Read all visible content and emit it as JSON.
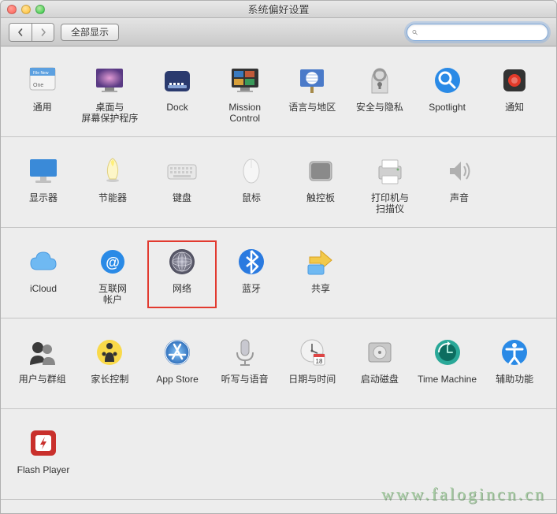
{
  "window": {
    "title": "系统偏好设置"
  },
  "toolbar": {
    "back_aria": "back",
    "forward_aria": "forward",
    "showall_label": "全部显示",
    "search_placeholder": ""
  },
  "sections": [
    {
      "items": [
        {
          "key": "general",
          "label": "通用"
        },
        {
          "key": "desktop",
          "label": "桌面与\n屏幕保护程序"
        },
        {
          "key": "dock",
          "label": "Dock"
        },
        {
          "key": "mission",
          "label": "Mission\nControl"
        },
        {
          "key": "language",
          "label": "语言与地区"
        },
        {
          "key": "security",
          "label": "安全与隐私"
        },
        {
          "key": "spotlight",
          "label": "Spotlight"
        },
        {
          "key": "notifications",
          "label": "通知"
        }
      ]
    },
    {
      "items": [
        {
          "key": "displays",
          "label": "显示器"
        },
        {
          "key": "energy",
          "label": "节能器"
        },
        {
          "key": "keyboard",
          "label": "键盘"
        },
        {
          "key": "mouse",
          "label": "鼠标"
        },
        {
          "key": "trackpad",
          "label": "触控板"
        },
        {
          "key": "printers",
          "label": "打印机与\n扫描仪"
        },
        {
          "key": "sound",
          "label": "声音"
        }
      ]
    },
    {
      "items": [
        {
          "key": "icloud",
          "label": "iCloud"
        },
        {
          "key": "internet",
          "label": "互联网\n帐户"
        },
        {
          "key": "network",
          "label": "网络",
          "highlight": true
        },
        {
          "key": "bluetooth",
          "label": "蓝牙"
        },
        {
          "key": "sharing",
          "label": "共享"
        }
      ]
    },
    {
      "items": [
        {
          "key": "users",
          "label": "用户与群组"
        },
        {
          "key": "parental",
          "label": "家长控制"
        },
        {
          "key": "appstore",
          "label": "App Store"
        },
        {
          "key": "dictation",
          "label": "听写与语音"
        },
        {
          "key": "datetime",
          "label": "日期与时间"
        },
        {
          "key": "startupdisk",
          "label": "启动磁盘"
        },
        {
          "key": "timemachine",
          "label": "Time Machine"
        },
        {
          "key": "accessibility",
          "label": "辅助功能"
        }
      ]
    },
    {
      "items": [
        {
          "key": "flash",
          "label": "Flash Player"
        }
      ]
    }
  ],
  "watermark": "www.falogincn.cn"
}
